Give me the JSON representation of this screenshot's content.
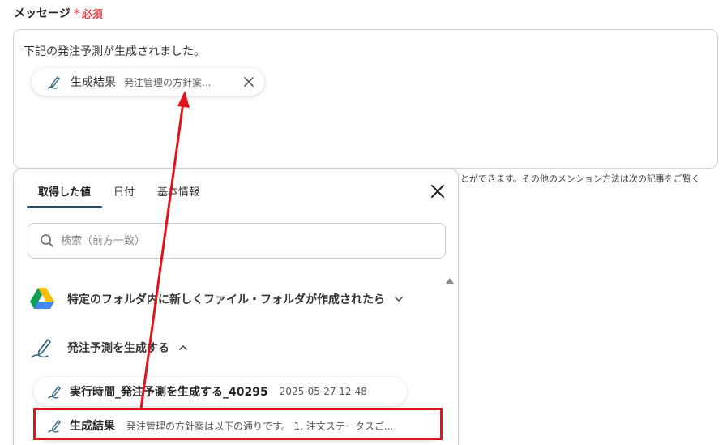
{
  "field": {
    "label": "メッセージ",
    "required_mark": "*",
    "required_text": "必須"
  },
  "message": {
    "text": "下記の発注予測が生成されました。",
    "chip": {
      "icon": "pen-icon",
      "title": "生成結果",
      "subtitle": "発注管理の方針案...",
      "close_icon": "close-icon"
    }
  },
  "helper_text": "とができます。その他のメンション方法は次の記事をご覧く",
  "panel": {
    "tabs": [
      {
        "label": "取得した値",
        "active": true
      },
      {
        "label": "日付",
        "active": false
      },
      {
        "label": "基本情報",
        "active": false
      }
    ],
    "search_placeholder": "検索（前方一致）",
    "groups": [
      {
        "icon": "google-drive-icon",
        "label": "特定のフォルダ内に新しくファイル・フォルダが作成されたら",
        "expanded": false
      },
      {
        "icon": "pen-icon",
        "label": "発注予測を生成する",
        "expanded": true
      }
    ],
    "items": [
      {
        "icon": "pen-icon",
        "title": "実行時間_発注予測を生成する_40295",
        "value": "2025-05-27 12:48"
      },
      {
        "icon": "pen-icon",
        "title": "生成結果",
        "value": "発注管理の方針案は以下の通りです。 1. 注文ステータスご..."
      }
    ]
  },
  "annotation_color": "#e0141b",
  "accent_color": "#2e4a5e"
}
